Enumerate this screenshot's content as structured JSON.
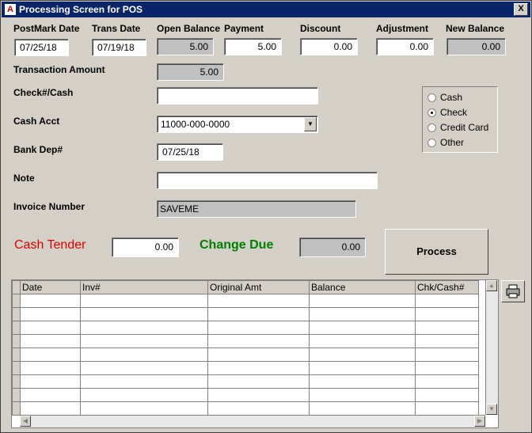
{
  "window": {
    "title": "Processing Screen for POS",
    "close_label": "X"
  },
  "labels": {
    "postmark_date": "PostMark Date",
    "trans_date": "Trans Date",
    "open_balance": "Open Balance",
    "payment": "Payment",
    "discount": "Discount",
    "adjustment": "Adjustment",
    "new_balance": "New Balance",
    "transaction_amount": "Transaction Amount",
    "check_cash": "Check#/Cash",
    "cash_acct": "Cash Acct",
    "bank_dep": "Bank Dep#",
    "note": "Note",
    "invoice_number": "Invoice Number",
    "cash_tender": "Cash Tender",
    "change_due": "Change Due"
  },
  "values": {
    "postmark_date": "07/25/18",
    "trans_date": "07/19/18",
    "open_balance": "5.00",
    "payment": "5.00",
    "discount": "0.00",
    "adjustment": "0.00",
    "new_balance": "0.00",
    "transaction_amount": "5.00",
    "check_cash": "",
    "cash_acct": "11000-000-0000",
    "bank_dep": "07/25/18",
    "note": "",
    "invoice_number": "SAVEME",
    "cash_tender": "0.00",
    "change_due": "0.00"
  },
  "payment_type": {
    "options": [
      "Cash",
      "Check",
      "Credit Card",
      "Other"
    ],
    "selected": "Check"
  },
  "buttons": {
    "process": "Process"
  },
  "table": {
    "columns": [
      "Date",
      "Inv#",
      "Original Amt",
      "Balance",
      "Chk/Cash#"
    ],
    "rows": [
      [
        "",
        "",
        "",
        "",
        ""
      ],
      [
        "",
        "",
        "",
        "",
        ""
      ],
      [
        "",
        "",
        "",
        "",
        ""
      ],
      [
        "",
        "",
        "",
        "",
        ""
      ],
      [
        "",
        "",
        "",
        "",
        ""
      ],
      [
        "",
        "",
        "",
        "",
        ""
      ],
      [
        "",
        "",
        "",
        "",
        ""
      ],
      [
        "",
        "",
        "",
        "",
        ""
      ],
      [
        "",
        "",
        "",
        "",
        ""
      ]
    ]
  },
  "colors": {
    "cash_tender": "#e00000",
    "change_due": "#008000",
    "titlebar": "#0a246a"
  },
  "icons": {
    "app": "app-icon",
    "print": "printer-icon"
  }
}
